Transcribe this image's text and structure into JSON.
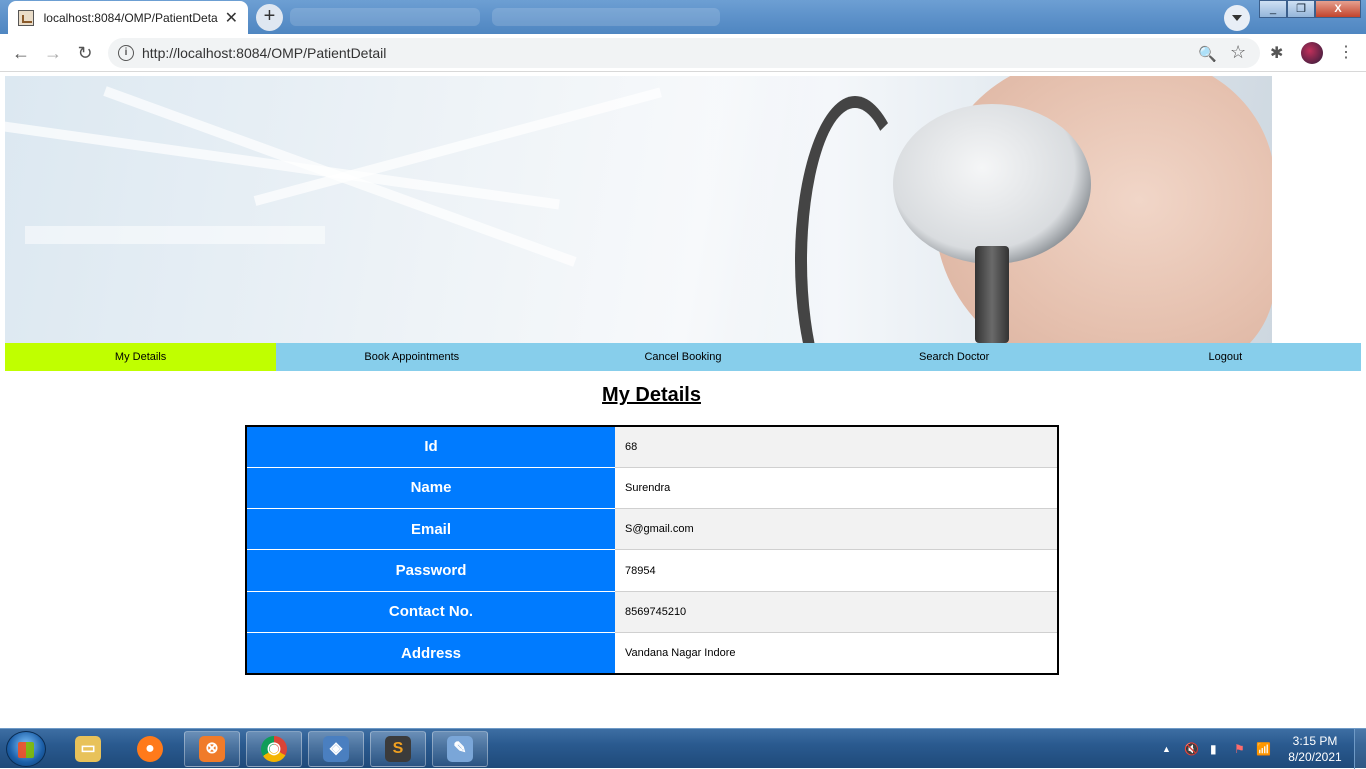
{
  "browser": {
    "tab_title": "localhost:8084/OMP/PatientDeta",
    "url": "http://localhost:8084/OMP/PatientDetail",
    "close_glyph": "✕",
    "new_tab_glyph": "+",
    "back_glyph": "←",
    "forward_glyph": "→",
    "reload_glyph": "↻",
    "info_glyph": "i",
    "zoom_glyph": "🔍",
    "star_glyph": "☆",
    "extensions_glyph": "✱",
    "menu_glyph": "⋮",
    "minimize_glyph": "_",
    "maximize_glyph": "❐",
    "close_window_glyph": "X"
  },
  "nav": {
    "items": [
      "My Details",
      "Book Appointments",
      "Cancel Booking",
      "Search Doctor",
      "Logout"
    ],
    "active_color": "#c0ff00",
    "bar_color": "#87ceeb"
  },
  "page": {
    "heading": "My Details"
  },
  "details": {
    "label_color": "#007bff",
    "rows": [
      {
        "label": "Id",
        "value": "68"
      },
      {
        "label": "Name",
        "value": "Surendra"
      },
      {
        "label": "Email",
        "value": "S@gmail.com"
      },
      {
        "label": "Password",
        "value": "78954"
      },
      {
        "label": "Contact No.",
        "value": "8569745210"
      },
      {
        "label": "Address",
        "value": "Vandana Nagar Indore"
      }
    ]
  },
  "taskbar": {
    "apps": [
      {
        "name": "file-explorer-icon",
        "glyph": "▭",
        "color": "#e8c25a"
      },
      {
        "name": "firefox-icon",
        "glyph": "●",
        "color": "#ff7a1a"
      },
      {
        "name": "xampp-icon",
        "glyph": "⊗",
        "color": "#f07b2a"
      },
      {
        "name": "chrome-icon",
        "glyph": "◉",
        "color": "#3a9f49"
      },
      {
        "name": "virtualbox-icon",
        "glyph": "◈",
        "color": "#4a7fc0"
      },
      {
        "name": "sublime-text-icon",
        "glyph": "S",
        "color": "#e08a1e"
      },
      {
        "name": "paint-icon",
        "glyph": "✎",
        "color": "#7aa6d8"
      }
    ],
    "time": "3:15 PM",
    "date": "8/20/2021",
    "tray_glyphs": [
      "▲",
      "🔇",
      "▮",
      "⚑",
      "📶"
    ]
  }
}
